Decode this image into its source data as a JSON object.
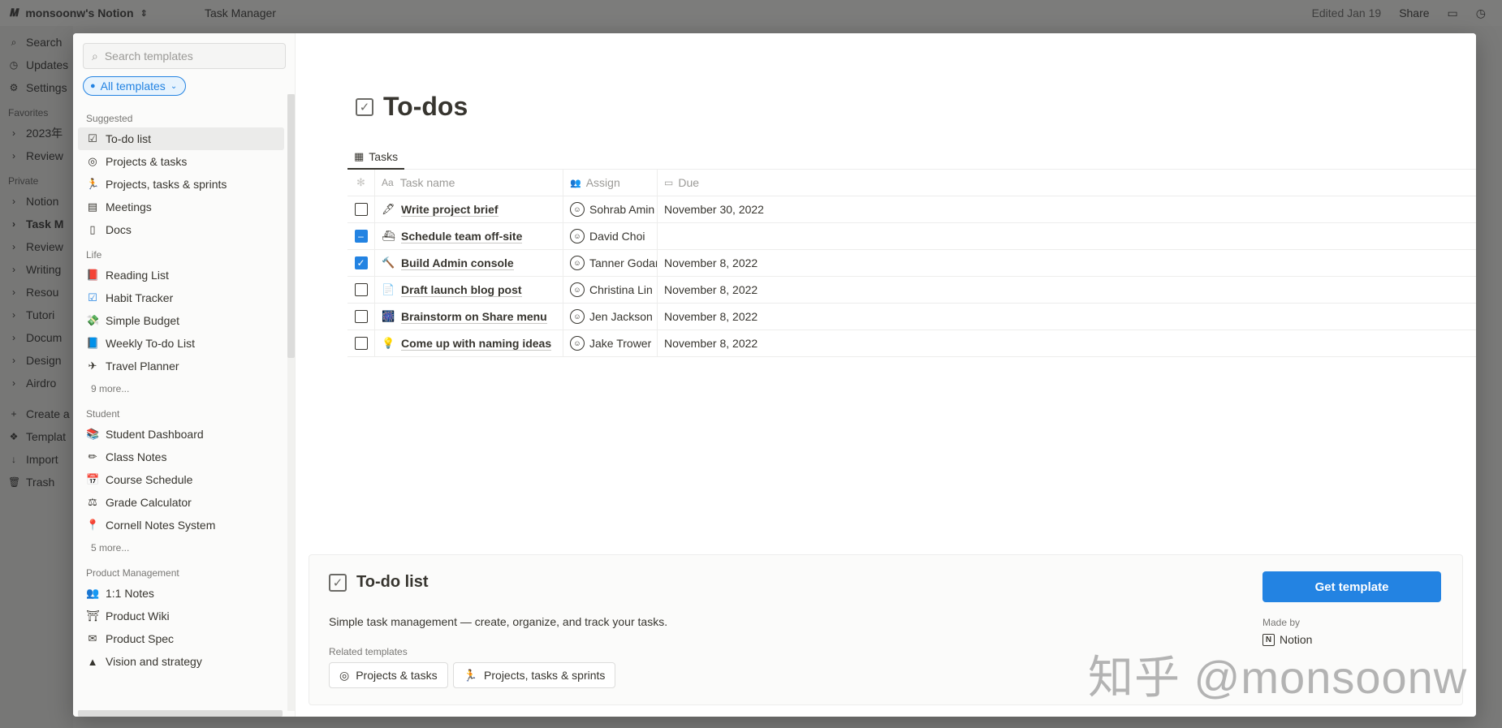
{
  "app": {
    "workspace": "monsoonw's Notion",
    "page_crumb": "Task Manager",
    "edited": "Edited Jan 19",
    "share": "Share"
  },
  "bg_sidebar": {
    "top_items": [
      "Search",
      "Updates",
      "Settings"
    ],
    "favorites_label": "Favorites",
    "favorites": [
      "2023年",
      "Review"
    ],
    "private_label": "Private",
    "private": [
      "Notion",
      "Task M",
      "Review",
      "Writing",
      "Resou",
      "Tutori",
      "Docum",
      "Design",
      "Airdro"
    ],
    "bottom": [
      "Create a",
      "Templat",
      "Import",
      "Trash"
    ]
  },
  "templates": {
    "search_placeholder": "Search templates",
    "filter_chip": "All templates",
    "groups": [
      {
        "label": "Suggested",
        "items": [
          {
            "label": "To-do list",
            "icon": "☑"
          },
          {
            "label": "Projects & tasks",
            "icon": "◎"
          },
          {
            "label": "Projects, tasks & sprints",
            "icon": "🏃"
          },
          {
            "label": "Meetings",
            "icon": "▤"
          },
          {
            "label": "Docs",
            "icon": "▯"
          }
        ],
        "more": ""
      },
      {
        "label": "Life",
        "items": [
          {
            "label": "Reading List",
            "icon": "📕"
          },
          {
            "label": "Habit Tracker",
            "icon": "☑"
          },
          {
            "label": "Simple Budget",
            "icon": "💸"
          },
          {
            "label": "Weekly To-do List",
            "icon": "📘"
          },
          {
            "label": "Travel Planner",
            "icon": "✈"
          }
        ],
        "more": "9 more..."
      },
      {
        "label": "Student",
        "items": [
          {
            "label": "Student Dashboard",
            "icon": "📚"
          },
          {
            "label": "Class Notes",
            "icon": "✏"
          },
          {
            "label": "Course Schedule",
            "icon": "📅"
          },
          {
            "label": "Grade Calculator",
            "icon": "⚖"
          },
          {
            "label": "Cornell Notes System",
            "icon": "📍"
          }
        ],
        "more": "5 more..."
      },
      {
        "label": "Product Management",
        "items": [
          {
            "label": "1:1 Notes",
            "icon": "👥"
          },
          {
            "label": "Product Wiki",
            "icon": "⛩"
          },
          {
            "label": "Product Spec",
            "icon": "✉"
          },
          {
            "label": "Vision and strategy",
            "icon": "▲"
          }
        ],
        "more": ""
      }
    ]
  },
  "preview": {
    "title": "To-dos",
    "tab": "Tasks",
    "columns": {
      "status": "",
      "name": "Task name",
      "assign": "Assign",
      "due": "Due"
    },
    "rows": [
      {
        "state": "unchecked",
        "emoji": "🖋",
        "name": "Write project brief",
        "assignee": "Sohrab Amin",
        "due": "November 30, 2022"
      },
      {
        "state": "partial",
        "emoji": "⛴",
        "name": "Schedule team off-site",
        "assignee": "David Choi",
        "due": ""
      },
      {
        "state": "checked",
        "emoji": "🔨",
        "name": "Build Admin console",
        "assignee": "Tanner Godar",
        "due": "November 8, 2022"
      },
      {
        "state": "unchecked",
        "emoji": "📄",
        "name": "Draft launch blog post",
        "assignee": "Christina Lin",
        "due": "November 8, 2022"
      },
      {
        "state": "unchecked",
        "emoji": "🎆",
        "name": "Brainstorm on Share menu",
        "assignee": "Jen Jackson",
        "due": "November 8, 2022"
      },
      {
        "state": "unchecked",
        "emoji": "💡",
        "name": "Come up with naming ideas",
        "assignee": "Jake Trower",
        "due": "November 8, 2022"
      }
    ]
  },
  "info": {
    "title": "To-do list",
    "description": "Simple task management — create, organize, and track your tasks.",
    "related_label": "Related templates",
    "related": [
      {
        "label": "Projects & tasks",
        "icon": "◎"
      },
      {
        "label": "Projects, tasks & sprints",
        "icon": "🏃"
      }
    ],
    "get_button": "Get template",
    "made_by_label": "Made by",
    "author": "Notion"
  },
  "watermark": "知乎 @monsoonw",
  "colors": {
    "accent": "#2383e2",
    "overlay": "#7a7a79",
    "text": "#37352f"
  }
}
